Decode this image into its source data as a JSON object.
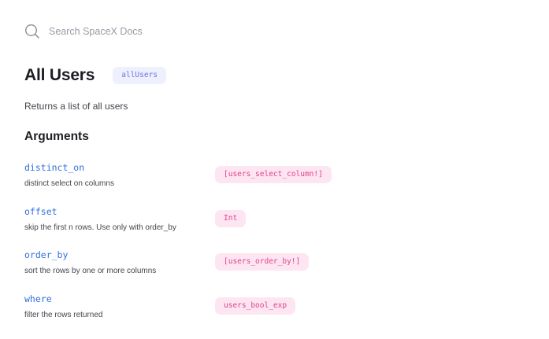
{
  "search": {
    "placeholder": "Search SpaceX Docs",
    "icon": "search-icon"
  },
  "query": {
    "title": "All Users",
    "name": "allUsers",
    "description": "Returns a list of all users"
  },
  "arguments": {
    "heading": "Arguments",
    "items": [
      {
        "name": "distinct_on",
        "description": "distinct select on columns",
        "type": "[users_select_column!]"
      },
      {
        "name": "offset",
        "description": "skip the first n rows. Use only with order_by",
        "type": "Int"
      },
      {
        "name": "order_by",
        "description": "sort the rows by one or more columns",
        "type": "[users_order_by!]"
      },
      {
        "name": "where",
        "description": "filter the rows returned",
        "type": "users_bool_exp"
      }
    ]
  },
  "colors": {
    "accent_blue": "#2f6fe0",
    "badge_bg": "#eef0fd",
    "badge_text": "#6b74e8",
    "type_bg": "#fde6f1",
    "type_text": "#e0428c"
  }
}
